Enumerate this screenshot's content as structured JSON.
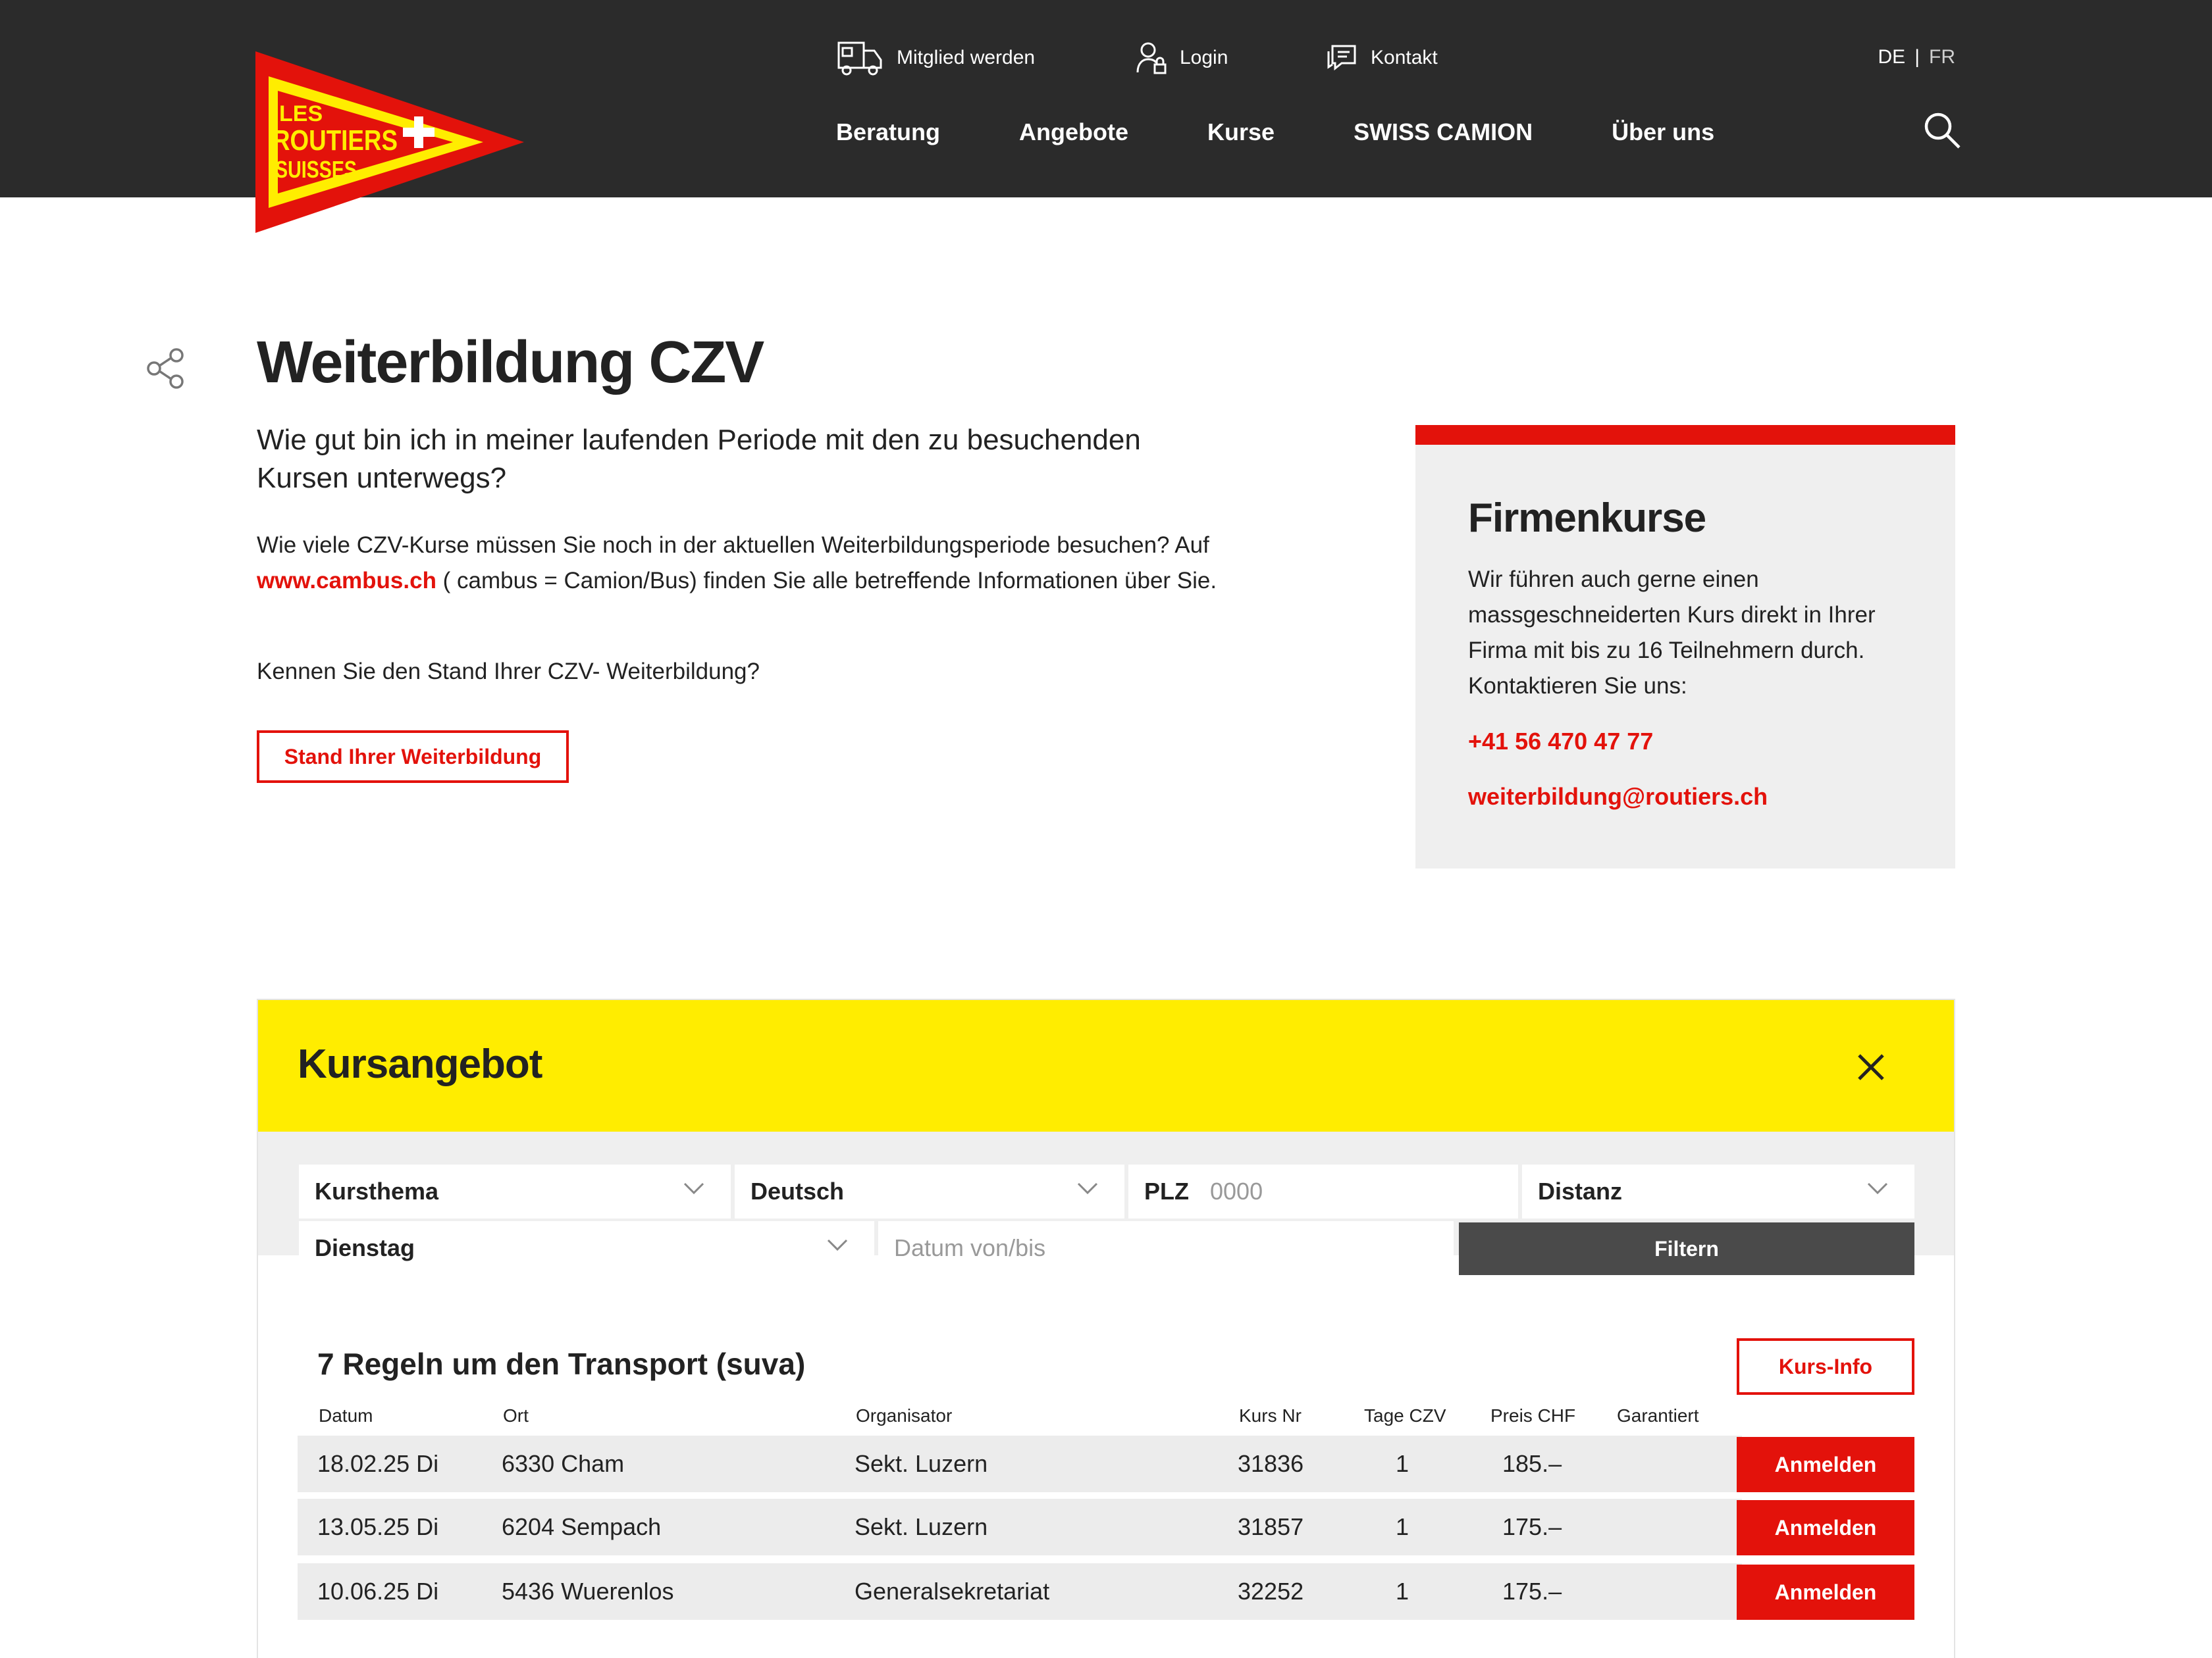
{
  "brand": {
    "logo_line1": "LES",
    "logo_line2": "ROUTIERS",
    "logo_line3": "SUISSES",
    "colors": {
      "red": "#e3120b",
      "yellow": "#ffed00",
      "dark": "#2b2b2b"
    }
  },
  "header": {
    "utility": [
      {
        "label": "Mitglied werden",
        "icon": "truck-icon"
      },
      {
        "label": "Login",
        "icon": "user-lock-icon"
      },
      {
        "label": "Kontakt",
        "icon": "chat-icon"
      }
    ],
    "lang": {
      "de": "DE",
      "sep": "|",
      "fr": "FR"
    },
    "nav": [
      "Beratung",
      "Angebote",
      "Kurse",
      "SWISS CAMION",
      "Über uns"
    ],
    "search_icon": "search-icon"
  },
  "intro": {
    "title": "Weiterbildung CZV",
    "lead": "Wie gut bin ich in meiner laufenden Periode mit den zu besuchenden Kursen unterwegs?",
    "p1_a": "Wie viele CZV-Kurse müssen Sie noch in der aktuellen Weiterbildungsperiode besuchen? Auf ",
    "p1_link": "www.cambus.ch",
    "p1_b": " ( cambus = Camion/Bus) finden Sie alle betreffende Informationen über Sie.",
    "p2": "Kennen Sie den Stand Ihrer CZV- Weiterbildung?",
    "button": "Stand Ihrer Weiterbildung"
  },
  "sidebox": {
    "title": "Firmenkurse",
    "text": "Wir führen auch gerne einen massgeschneiderten Kurs direkt in Ihrer Firma mit bis zu 16 Teilnehmern durch. Kontaktieren Sie uns:",
    "phone": "+41 56 470 47 77",
    "email": "weiterbildung@routiers.ch"
  },
  "courses": {
    "title": "Kursangebot",
    "filters": {
      "topic": "Kursthema",
      "language": "Deutsch",
      "plz_label": "PLZ",
      "plz_placeholder": "0000",
      "distance": "Distanz",
      "weekday": "Dienstag",
      "date_placeholder": "Datum von/bis",
      "filter_button": "Filtern"
    },
    "course_name": "7 Regeln um den Transport (suva)",
    "info_button": "Kurs-Info",
    "columns": [
      "Datum",
      "Ort",
      "Organisator",
      "Kurs Nr",
      "Tage CZV",
      "Preis CHF",
      "Garantiert"
    ],
    "rows": [
      {
        "date": "18.02.25 Di",
        "place": "6330 Cham",
        "org": "Sekt. Luzern",
        "nr": "31836",
        "days": "1",
        "price": "185.–",
        "button": "Anmelden"
      },
      {
        "date": "13.05.25 Di",
        "place": "6204 Sempach",
        "org": "Sekt. Luzern",
        "nr": "31857",
        "days": "1",
        "price": "175.–",
        "button": "Anmelden"
      },
      {
        "date": "10.06.25 Di",
        "place": "5436 Wuerenlos",
        "org": "Generalsekretariat",
        "nr": "32252",
        "days": "1",
        "price": "175.–",
        "button": "Anmelden"
      }
    ]
  }
}
